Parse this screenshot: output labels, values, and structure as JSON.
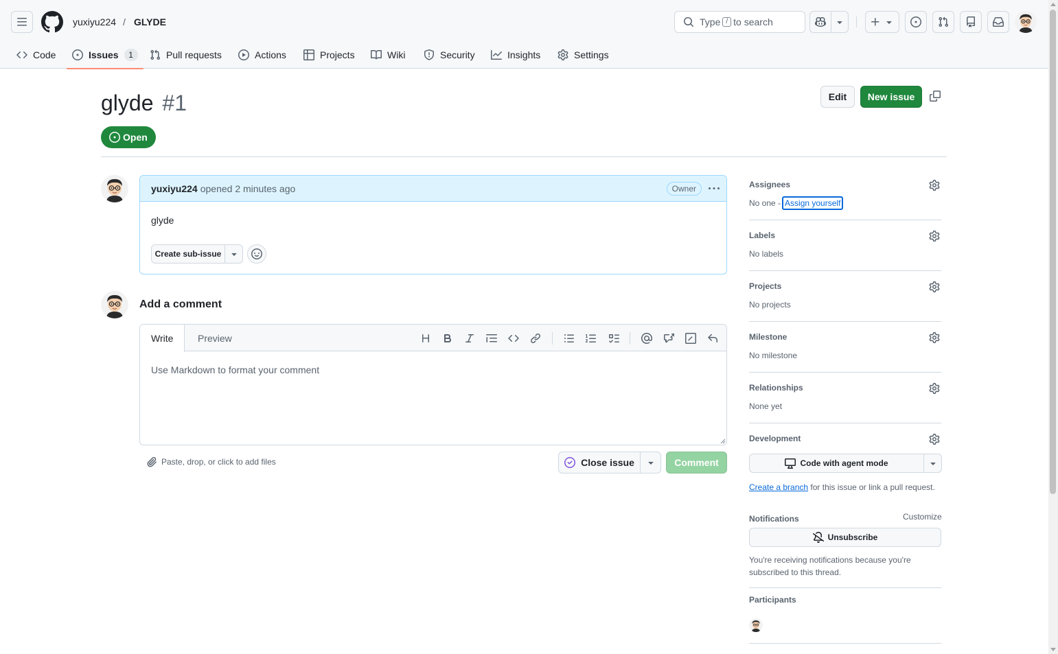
{
  "header": {
    "owner": "yuxiyu224",
    "separator": "/",
    "repo": "GLYDE",
    "search": {
      "prefix": "Type",
      "key": "/",
      "suffix": "to search"
    }
  },
  "tabs": [
    {
      "label": "Code",
      "icon": "code-icon"
    },
    {
      "label": "Issues",
      "icon": "issue-opened-icon",
      "count": "1"
    },
    {
      "label": "Pull requests",
      "icon": "git-pull-request-icon"
    },
    {
      "label": "Actions",
      "icon": "play-icon"
    },
    {
      "label": "Projects",
      "icon": "table-icon"
    },
    {
      "label": "Wiki",
      "icon": "book-icon"
    },
    {
      "label": "Security",
      "icon": "shield-icon"
    },
    {
      "label": "Insights",
      "icon": "graph-icon"
    },
    {
      "label": "Settings",
      "icon": "gear-icon"
    }
  ],
  "issue": {
    "title": "glyde",
    "number": "#1",
    "state": "Open",
    "edit_label": "Edit",
    "new_issue_label": "New issue"
  },
  "comment": {
    "author": "yuxiyu224",
    "meta": "opened 2 minutes ago",
    "role": "Owner",
    "body": "glyde",
    "sub_issue_label": "Create sub-issue"
  },
  "composer": {
    "heading": "Add a comment",
    "tab_write": "Write",
    "tab_preview": "Preview",
    "placeholder": "Use Markdown to format your comment",
    "attach_hint": "Paste, drop, or click to add files",
    "close_label": "Close issue",
    "comment_label": "Comment"
  },
  "sidebar": {
    "assignees": {
      "title": "Assignees",
      "value": "No one -",
      "link": "Assign yourself"
    },
    "labels": {
      "title": "Labels",
      "value": "No labels"
    },
    "projects": {
      "title": "Projects",
      "value": "No projects"
    },
    "milestone": {
      "title": "Milestone",
      "value": "No milestone"
    },
    "relationships": {
      "title": "Relationships",
      "value": "None yet"
    },
    "development": {
      "title": "Development",
      "agent_label": "Code with agent mode",
      "branch_link": "Create a branch",
      "branch_text": "for this issue or link a pull request."
    },
    "notifications": {
      "title": "Notifications",
      "customize": "Customize",
      "unsubscribe": "Unsubscribe",
      "reason": "You're receiving notifications because you're subscribed to this thread."
    },
    "participants": {
      "title": "Participants"
    }
  },
  "colors": {
    "accent": "#0969da",
    "open_green": "#1f883d",
    "tab_underline": "#fd8c73",
    "comment_header": "#ddf4ff"
  }
}
